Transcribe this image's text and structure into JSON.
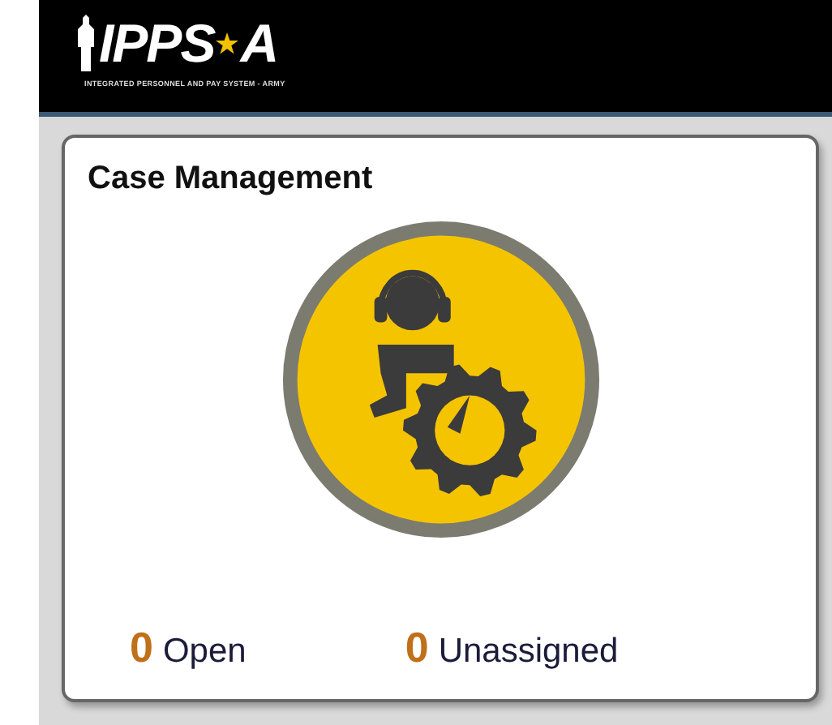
{
  "header": {
    "logo_left": "IPPS",
    "logo_right": "A",
    "tagline": "INTEGRATED PERSONNEL AND PAY SYSTEM - ARMY"
  },
  "card": {
    "title": "Case Management",
    "counts": [
      {
        "value": "0",
        "label": "Open"
      },
      {
        "value": "0",
        "label": "Unassigned"
      }
    ]
  }
}
